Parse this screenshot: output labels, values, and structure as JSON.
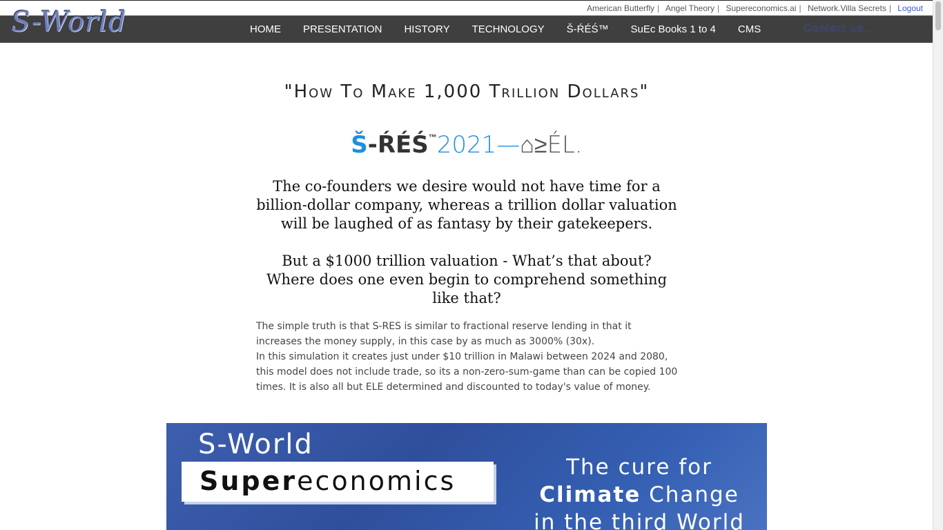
{
  "header": {
    "logo_text": "S-World",
    "top_links": [
      "American Butterfly",
      "Angel Theory",
      "Supereconomics.ai",
      "Network.Villa Secrets"
    ],
    "logout_label": "Logout",
    "nav": [
      "HOME",
      "PRESENTATION",
      "HISTORY",
      "TECHNOLOGY",
      "Š-ŔÉŚ™",
      "SuEc Books 1 to 4",
      "CMS"
    ],
    "contact_label": "Contact us.."
  },
  "main": {
    "title": "\"How To Make 1,000 Trillion Dollars\"",
    "sres_logo": {
      "s": "Š",
      "res": "-ŔÉŚ",
      "tm": "™",
      "year": "2021—",
      "ele": "⌂≥ÉL."
    },
    "para1": "The co-founders we desire would not have time for a billion-dollar company, whereas a trillion dollar valuation will be laughed of as fantasy by their gatekeepers.",
    "para2_line1": "But a $1000 trillion valuation - What’s that about?",
    "para2_line2": "Where does one even begin to comprehend something like that?",
    "body_line1": "The simple truth is that S-RES is similar to fractional reserve lending in that it increases the money supply, in this case by as much as 3000% (30x).",
    "body_line2": "In this simulation it creates just under $10 trillion in Malawi between 2024 and 2080, this model does not include trade, so its a non-zero-sum-game than can be copied 100 times. It is also all but ELE determined and discounted to today's value of money."
  },
  "banner": {
    "sworld": "S-World",
    "super_bold": "Super",
    "super_rest": "economics",
    "cure_line1": "The cure for",
    "cure_bold": "Climate",
    "cure_line2_rest": " Change",
    "cure_line3": "in the third World"
  },
  "colors": {
    "header_bg": "#3f3f3f",
    "accent_blue": "#1e8ee0",
    "logout_link": "#3b5bdb",
    "banner_blue": "#2f4f9c"
  }
}
